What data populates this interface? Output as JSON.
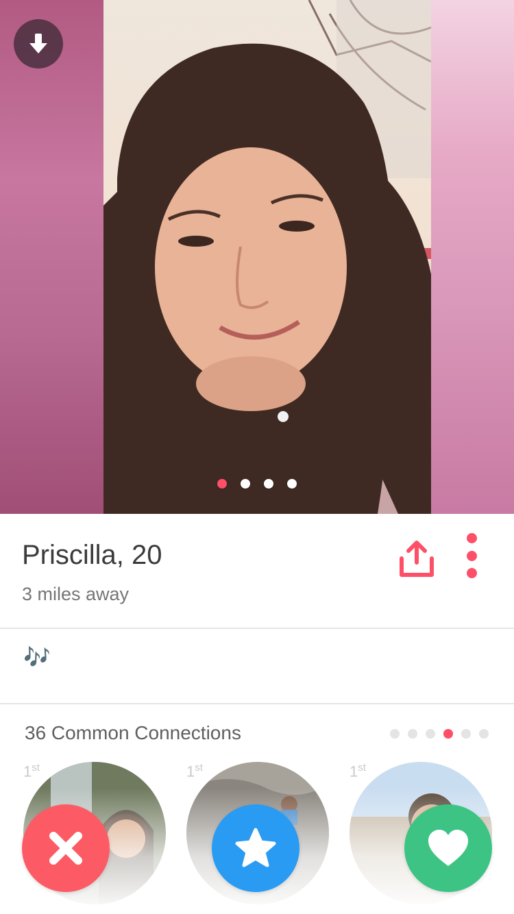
{
  "profile": {
    "name_age": "Priscilla, 20",
    "distance": "3 miles away",
    "bio": "🎶",
    "photo_count": 4,
    "active_photo_index": 0
  },
  "connections": {
    "title": "36 Common Connections",
    "page_count": 6,
    "active_page_index": 3,
    "items": [
      {
        "degree": "1",
        "degree_suffix": "st"
      },
      {
        "degree": "1",
        "degree_suffix": "st"
      },
      {
        "degree": "1",
        "degree_suffix": "st"
      }
    ]
  },
  "icons": {
    "download": "arrow-down-circle-icon",
    "share": "share-icon",
    "more": "vertical-ellipsis-icon",
    "nope": "x-icon",
    "superlike": "star-icon",
    "like": "heart-icon"
  },
  "colors": {
    "accent": "#fd5068",
    "nope": "#fc5b65",
    "superlike": "#2a9bf2",
    "like": "#3dc484"
  }
}
